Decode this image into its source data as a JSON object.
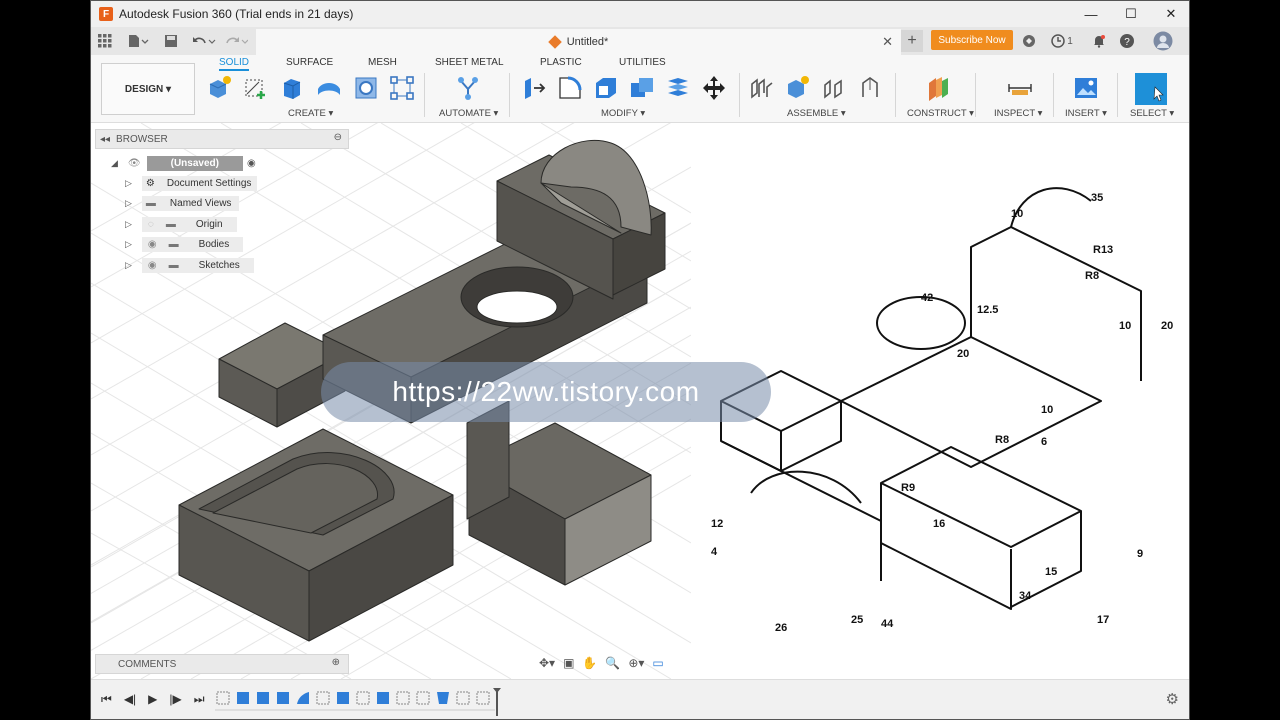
{
  "window": {
    "title": "Autodesk Fusion 360 (Trial ends in 21 days)"
  },
  "tabrow": {
    "doc_title": "Untitled*",
    "subscribe_label": "Subscribe Now",
    "jobs_count": "1"
  },
  "ribbon": {
    "workspace": "DESIGN ▾",
    "tabs": [
      {
        "label": "SOLID",
        "active": true
      },
      {
        "label": "SURFACE"
      },
      {
        "label": "MESH"
      },
      {
        "label": "SHEET METAL"
      },
      {
        "label": "PLASTIC"
      },
      {
        "label": "UTILITIES"
      }
    ],
    "groups": {
      "create": "CREATE ▾",
      "automate": "AUTOMATE ▾",
      "modify": "MODIFY ▾",
      "assemble": "ASSEMBLE ▾",
      "construct": "CONSTRUCT ▾",
      "inspect": "INSPECT ▾",
      "insert": "INSERT ▾",
      "select": "SELECT ▾"
    }
  },
  "browser": {
    "title": "BROWSER",
    "root": "(Unsaved)",
    "items": [
      {
        "label": "Document Settings",
        "icon": "gear-icon"
      },
      {
        "label": "Named Views",
        "icon": "folder-icon"
      },
      {
        "label": "Origin",
        "icon": "folder-icon"
      },
      {
        "label": "Bodies",
        "icon": "folder-icon"
      },
      {
        "label": "Sketches",
        "icon": "folder-icon"
      }
    ]
  },
  "comments": {
    "title": "COMMENTS"
  },
  "watermark": "https://22ww.tistory.com",
  "drawing_dims": [
    "35",
    "10",
    "R13",
    "R8",
    "42",
    "12.5",
    "10",
    "20",
    "20",
    "10",
    "R8",
    "6",
    "R9",
    "12",
    "4",
    "16",
    "9",
    "15",
    "26",
    "25",
    "44",
    "34",
    "17"
  ],
  "colors": {
    "accent": "#1a8fd9",
    "subscribe": "#f08c1e",
    "body": "#55534e"
  }
}
